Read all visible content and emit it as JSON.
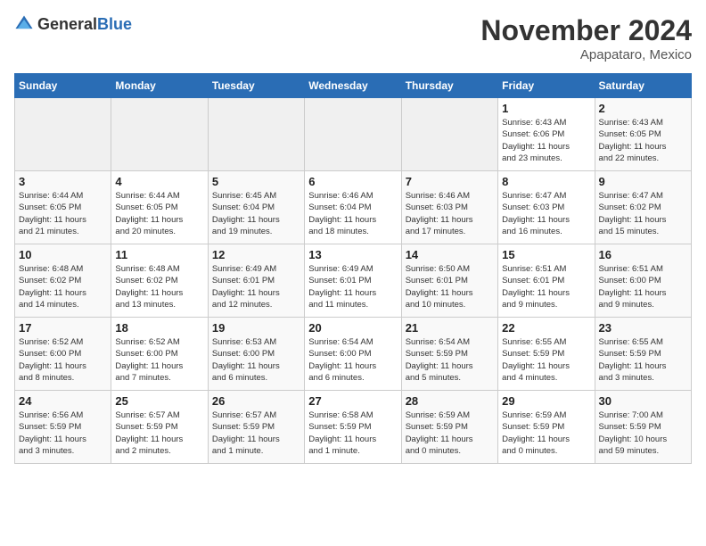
{
  "header": {
    "logo_general": "General",
    "logo_blue": "Blue",
    "title": "November 2024",
    "location": "Apapataro, Mexico"
  },
  "weekdays": [
    "Sunday",
    "Monday",
    "Tuesday",
    "Wednesday",
    "Thursday",
    "Friday",
    "Saturday"
  ],
  "weeks": [
    [
      {
        "day": "",
        "info": ""
      },
      {
        "day": "",
        "info": ""
      },
      {
        "day": "",
        "info": ""
      },
      {
        "day": "",
        "info": ""
      },
      {
        "day": "",
        "info": ""
      },
      {
        "day": "1",
        "info": "Sunrise: 6:43 AM\nSunset: 6:06 PM\nDaylight: 11 hours\nand 23 minutes."
      },
      {
        "day": "2",
        "info": "Sunrise: 6:43 AM\nSunset: 6:05 PM\nDaylight: 11 hours\nand 22 minutes."
      }
    ],
    [
      {
        "day": "3",
        "info": "Sunrise: 6:44 AM\nSunset: 6:05 PM\nDaylight: 11 hours\nand 21 minutes."
      },
      {
        "day": "4",
        "info": "Sunrise: 6:44 AM\nSunset: 6:05 PM\nDaylight: 11 hours\nand 20 minutes."
      },
      {
        "day": "5",
        "info": "Sunrise: 6:45 AM\nSunset: 6:04 PM\nDaylight: 11 hours\nand 19 minutes."
      },
      {
        "day": "6",
        "info": "Sunrise: 6:46 AM\nSunset: 6:04 PM\nDaylight: 11 hours\nand 18 minutes."
      },
      {
        "day": "7",
        "info": "Sunrise: 6:46 AM\nSunset: 6:03 PM\nDaylight: 11 hours\nand 17 minutes."
      },
      {
        "day": "8",
        "info": "Sunrise: 6:47 AM\nSunset: 6:03 PM\nDaylight: 11 hours\nand 16 minutes."
      },
      {
        "day": "9",
        "info": "Sunrise: 6:47 AM\nSunset: 6:02 PM\nDaylight: 11 hours\nand 15 minutes."
      }
    ],
    [
      {
        "day": "10",
        "info": "Sunrise: 6:48 AM\nSunset: 6:02 PM\nDaylight: 11 hours\nand 14 minutes."
      },
      {
        "day": "11",
        "info": "Sunrise: 6:48 AM\nSunset: 6:02 PM\nDaylight: 11 hours\nand 13 minutes."
      },
      {
        "day": "12",
        "info": "Sunrise: 6:49 AM\nSunset: 6:01 PM\nDaylight: 11 hours\nand 12 minutes."
      },
      {
        "day": "13",
        "info": "Sunrise: 6:49 AM\nSunset: 6:01 PM\nDaylight: 11 hours\nand 11 minutes."
      },
      {
        "day": "14",
        "info": "Sunrise: 6:50 AM\nSunset: 6:01 PM\nDaylight: 11 hours\nand 10 minutes."
      },
      {
        "day": "15",
        "info": "Sunrise: 6:51 AM\nSunset: 6:01 PM\nDaylight: 11 hours\nand 9 minutes."
      },
      {
        "day": "16",
        "info": "Sunrise: 6:51 AM\nSunset: 6:00 PM\nDaylight: 11 hours\nand 9 minutes."
      }
    ],
    [
      {
        "day": "17",
        "info": "Sunrise: 6:52 AM\nSunset: 6:00 PM\nDaylight: 11 hours\nand 8 minutes."
      },
      {
        "day": "18",
        "info": "Sunrise: 6:52 AM\nSunset: 6:00 PM\nDaylight: 11 hours\nand 7 minutes."
      },
      {
        "day": "19",
        "info": "Sunrise: 6:53 AM\nSunset: 6:00 PM\nDaylight: 11 hours\nand 6 minutes."
      },
      {
        "day": "20",
        "info": "Sunrise: 6:54 AM\nSunset: 6:00 PM\nDaylight: 11 hours\nand 6 minutes."
      },
      {
        "day": "21",
        "info": "Sunrise: 6:54 AM\nSunset: 5:59 PM\nDaylight: 11 hours\nand 5 minutes."
      },
      {
        "day": "22",
        "info": "Sunrise: 6:55 AM\nSunset: 5:59 PM\nDaylight: 11 hours\nand 4 minutes."
      },
      {
        "day": "23",
        "info": "Sunrise: 6:55 AM\nSunset: 5:59 PM\nDaylight: 11 hours\nand 3 minutes."
      }
    ],
    [
      {
        "day": "24",
        "info": "Sunrise: 6:56 AM\nSunset: 5:59 PM\nDaylight: 11 hours\nand 3 minutes."
      },
      {
        "day": "25",
        "info": "Sunrise: 6:57 AM\nSunset: 5:59 PM\nDaylight: 11 hours\nand 2 minutes."
      },
      {
        "day": "26",
        "info": "Sunrise: 6:57 AM\nSunset: 5:59 PM\nDaylight: 11 hours\nand 1 minute."
      },
      {
        "day": "27",
        "info": "Sunrise: 6:58 AM\nSunset: 5:59 PM\nDaylight: 11 hours\nand 1 minute."
      },
      {
        "day": "28",
        "info": "Sunrise: 6:59 AM\nSunset: 5:59 PM\nDaylight: 11 hours\nand 0 minutes."
      },
      {
        "day": "29",
        "info": "Sunrise: 6:59 AM\nSunset: 5:59 PM\nDaylight: 11 hours\nand 0 minutes."
      },
      {
        "day": "30",
        "info": "Sunrise: 7:00 AM\nSunset: 5:59 PM\nDaylight: 10 hours\nand 59 minutes."
      }
    ]
  ]
}
